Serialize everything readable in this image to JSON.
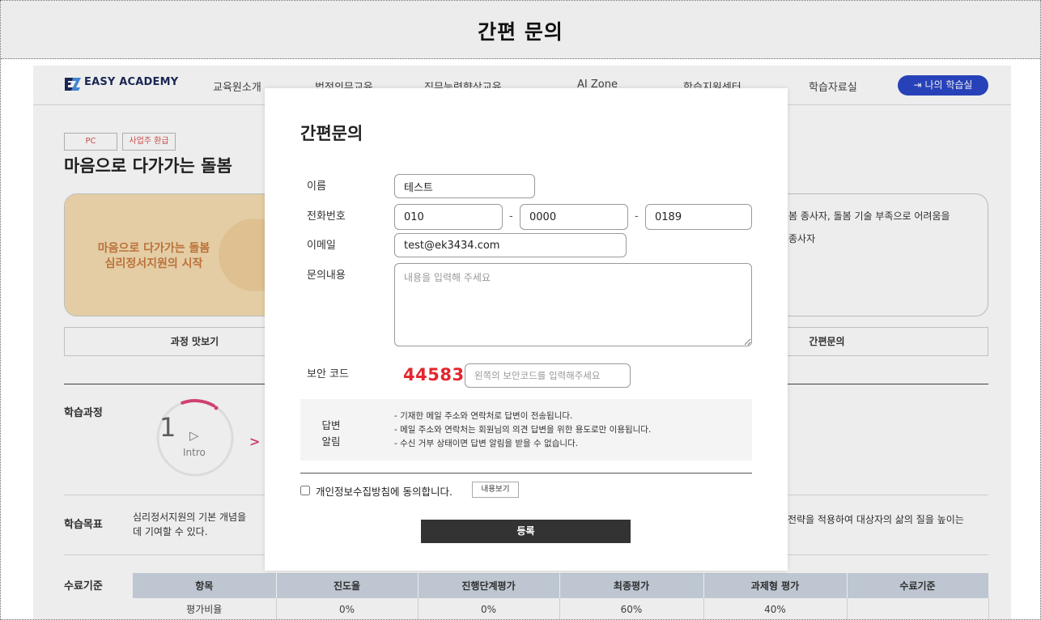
{
  "header": {
    "title": "간편 문의"
  },
  "site": {
    "logo": "EASY ACADEMY",
    "nav": [
      "교육원소개",
      "법정의무교육",
      "직무능력향상교육",
      "AI Zone",
      "학습지원센터",
      "학습자료실"
    ],
    "my_class_button": "나의 학습실",
    "tags": [
      "PC",
      "사업주 환급"
    ],
    "course_title": "마음으로 다가가는 돌봄",
    "banner_lines": [
      "마음으로 다가가는 돌봄",
      "심리정서지원의 시작"
    ],
    "intro_lines": [
      "봄 종사자, 돌봄 기술 부족으로 어려움을",
      "종사자"
    ],
    "tabs": [
      "과정 맛보기",
      "간편문의"
    ],
    "course": {
      "label": "학습과정",
      "step_number": "1",
      "step_label": "Intro"
    },
    "goal": {
      "label": "학습목표",
      "left_lines": [
        "심리정서지원의 기본 개념을",
        "데 기여할 수 있다."
      ],
      "right_text": "전략을 적용하여 대상자의 삶의 질을 높이는"
    },
    "criteria": {
      "label": "수료기준",
      "headers": [
        "항목",
        "진도율",
        "진행단계평가",
        "최종평가",
        "과제형 평가",
        "수료기준"
      ],
      "rows": [
        [
          "평가비율",
          "0%",
          "0%",
          "60%",
          "40%",
          ""
        ]
      ]
    }
  },
  "modal": {
    "title": "간편문의",
    "name": {
      "label": "이름",
      "value": "테스트"
    },
    "phone": {
      "label": "전화번호",
      "part1": "010",
      "part2": "0000",
      "part3": "0189",
      "separator": "-"
    },
    "email": {
      "label": "이메일",
      "value": "test@ek3434.com"
    },
    "message": {
      "label": "문의내용",
      "placeholder": "내용을 입력해 주세요"
    },
    "captcha": {
      "label": "보안 코드",
      "code": "44583",
      "placeholder": "왼쪽의 보안코드를 입력해주세요"
    },
    "notice": {
      "label_lines": [
        "답변",
        "알림"
      ],
      "lines": [
        "- 기재한 메일 주소와 연락처로 답변이 전송됩니다.",
        "- 메일 주소와 연락처는 회원님의 의견 답변을 위한 용도로만 이용됩니다.",
        "- 수신 거부 상태이면 답변 알림을 받을 수 없습니다."
      ]
    },
    "consent": {
      "label": "개인정보수집방침에 동의합니다.",
      "view_button": "내용보기",
      "checked": false
    },
    "submit": "등록"
  },
  "colors": {
    "accent_blue": "#2b48c8",
    "captcha_red": "#e3262e",
    "progress_pink": "#e0457a",
    "submit_dark": "#333333",
    "table_header": "#ccd6e1",
    "banner_bg": "#f6ddb2"
  },
  "icons": [
    "ez-logo-icon",
    "login-icon",
    "play-icon",
    "chevron-right-icon",
    "checkbox"
  ]
}
